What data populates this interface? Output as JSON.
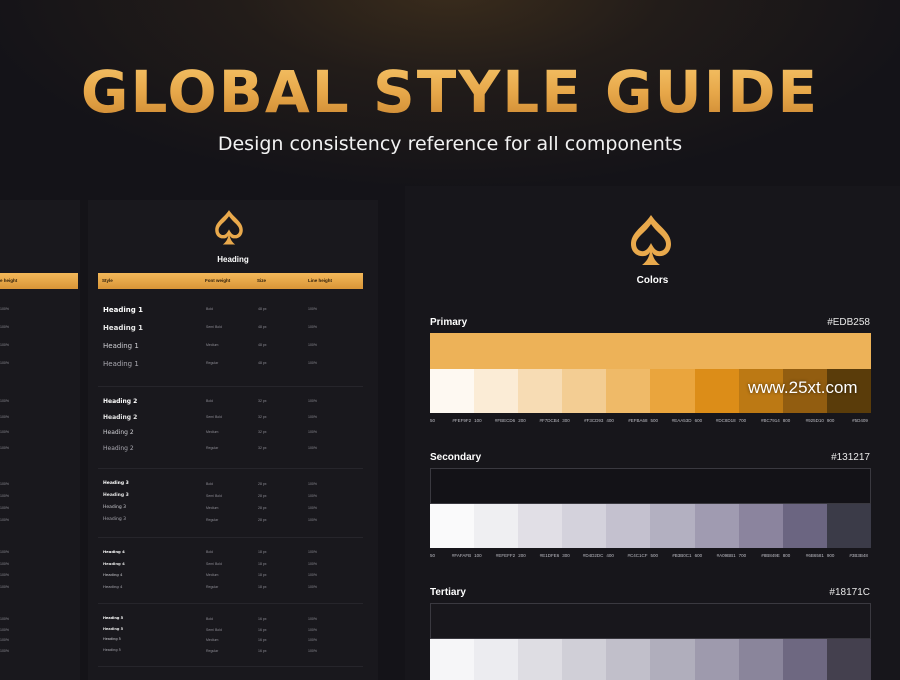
{
  "header": {
    "title": "GLOBAL STYLE GUIDE",
    "subtitle": "Design consistency reference for all components"
  },
  "typography": {
    "section_title": "Heading",
    "columns": [
      "Style",
      "Font weight",
      "Size",
      "Line height"
    ],
    "left_column_header": "e height",
    "groups": [
      {
        "rows": [
          {
            "style": "Heading 1",
            "weight": "Bold",
            "size": "48 px",
            "line": "100%"
          },
          {
            "style": "Heading 1",
            "weight": "Semi Bold",
            "size": "48 px",
            "line": "100%"
          },
          {
            "style": "Heading 1",
            "weight": "Medium",
            "size": "48 px",
            "line": "100%"
          },
          {
            "style": "Heading 1",
            "weight": "Regular",
            "size": "48 px",
            "line": "100%"
          }
        ]
      },
      {
        "rows": [
          {
            "style": "Heading 2",
            "weight": "Bold",
            "size": "32 px",
            "line": "100%"
          },
          {
            "style": "Heading 2",
            "weight": "Semi Bold",
            "size": "32 px",
            "line": "100%"
          },
          {
            "style": "Heading 2",
            "weight": "Medium",
            "size": "32 px",
            "line": "100%"
          },
          {
            "style": "Heading 2",
            "weight": "Regular",
            "size": "32 px",
            "line": "100%"
          }
        ]
      },
      {
        "rows": [
          {
            "style": "Heading 3",
            "weight": "Bold",
            "size": "28 px",
            "line": "100%"
          },
          {
            "style": "Heading 3",
            "weight": "Semi Bold",
            "size": "28 px",
            "line": "100%"
          },
          {
            "style": "Heading 3",
            "weight": "Medium",
            "size": "28 px",
            "line": "100%"
          },
          {
            "style": "Heading 3",
            "weight": "Regular",
            "size": "28 px",
            "line": "100%"
          }
        ]
      },
      {
        "rows": [
          {
            "style": "Heading 4",
            "weight": "Bold",
            "size": "18 px",
            "line": "100%"
          },
          {
            "style": "Heading 4",
            "weight": "Semi Bold",
            "size": "18 px",
            "line": "100%"
          },
          {
            "style": "Heading 4",
            "weight": "Medium",
            "size": "18 px",
            "line": "100%"
          },
          {
            "style": "Heading 4",
            "weight": "Regular",
            "size": "18 px",
            "line": "100%"
          }
        ]
      },
      {
        "rows": [
          {
            "style": "Heading 5",
            "weight": "Bold",
            "size": "16 px",
            "line": "100%"
          },
          {
            "style": "Heading 5",
            "weight": "Semi Bold",
            "size": "16 px",
            "line": "100%"
          },
          {
            "style": "Heading 5",
            "weight": "Medium",
            "size": "16 px",
            "line": "100%"
          },
          {
            "style": "Heading 5",
            "weight": "Regular",
            "size": "16 px",
            "line": "100%"
          }
        ]
      }
    ]
  },
  "colors": {
    "section_title": "Colors",
    "palettes": [
      {
        "name": "Primary",
        "hex": "#EDB258",
        "main": "#EDB258",
        "shades": [
          {
            "step": "50",
            "hex": "#FEF9F2",
            "color": "#FEF9F2"
          },
          {
            "step": "100",
            "hex": "#FBECD6",
            "color": "#FBECD6"
          },
          {
            "step": "200",
            "hex": "#F7DCB4",
            "color": "#F7DCB4"
          },
          {
            "step": "300",
            "hex": "#F3CD93",
            "color": "#F3CD93"
          },
          {
            "step": "400",
            "hex": "#EFBA68",
            "color": "#EFBA68"
          },
          {
            "step": "500",
            "hex": "#EAA53D",
            "color": "#EAA53D"
          },
          {
            "step": "600",
            "hex": "#DC8D18",
            "color": "#DC8D18"
          },
          {
            "step": "700",
            "hex": "#BC7914",
            "color": "#BC7914"
          },
          {
            "step": "800",
            "hex": "#925D10",
            "color": "#925D10"
          },
          {
            "step": "900",
            "hex": "#5D409",
            "color": "#5A3C0A"
          }
        ]
      },
      {
        "name": "Secondary",
        "hex": "#131217",
        "main": "#131217",
        "shades": [
          {
            "step": "50",
            "hex": "#FAFAFB",
            "color": "#FAFAFB"
          },
          {
            "step": "100",
            "hex": "#EFEFF2",
            "color": "#EFEFF2"
          },
          {
            "step": "200",
            "hex": "#E1DFE6",
            "color": "#E1DFE6"
          },
          {
            "step": "300",
            "hex": "#D4D2DC",
            "color": "#D4D2DC"
          },
          {
            "step": "400",
            "hex": "#C4C1CF",
            "color": "#C4C1CF"
          },
          {
            "step": "500",
            "hex": "#B3B0C1",
            "color": "#B3B0C1"
          },
          {
            "step": "600",
            "hex": "#A09BB1",
            "color": "#A09BB1"
          },
          {
            "step": "700",
            "hex": "#8B849E",
            "color": "#8B849E"
          },
          {
            "step": "800",
            "hex": "#6B6581",
            "color": "#6B6581"
          },
          {
            "step": "900",
            "hex": "#3B3B48",
            "color": "#3B3B48"
          }
        ]
      },
      {
        "name": "Tertiary",
        "hex": "#18171C",
        "main": "#18171C",
        "shades": [
          {
            "step": "",
            "hex": "",
            "color": "#F6F6F8"
          },
          {
            "step": "",
            "hex": "",
            "color": "#ECECF0"
          },
          {
            "step": "",
            "hex": "",
            "color": "#DEDDE3"
          },
          {
            "step": "",
            "hex": "",
            "color": "#D0CFD7"
          },
          {
            "step": "",
            "hex": "",
            "color": "#C1BFCA"
          },
          {
            "step": "",
            "hex": "",
            "color": "#B0AEBC"
          },
          {
            "step": "",
            "hex": "",
            "color": "#9E9AAD"
          },
          {
            "step": "",
            "hex": "",
            "color": "#8A859B"
          },
          {
            "step": "",
            "hex": "",
            "color": "#6E6881"
          },
          {
            "step": "",
            "hex": "",
            "color": "#44404E"
          }
        ]
      }
    ]
  },
  "watermark": "www.25xt.com",
  "accent": "#EDB258"
}
